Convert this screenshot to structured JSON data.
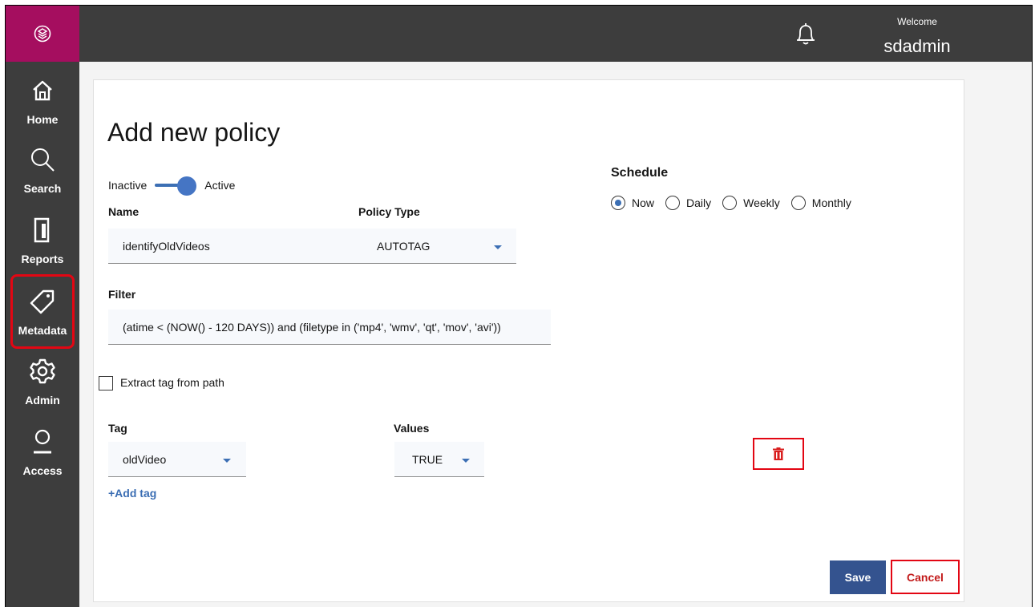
{
  "app": {
    "brand_color": "#a50e5f",
    "sidebar_color": "#3d3d3d",
    "accent": "#3c6fb4",
    "danger": "#e30613"
  },
  "header": {
    "welcome": "Welcome",
    "username": "sdadmin",
    "notification_icon": "bell-icon"
  },
  "sidebar": {
    "items": [
      {
        "label": "Home",
        "icon": "home-icon"
      },
      {
        "label": "Search",
        "icon": "search-icon"
      },
      {
        "label": "Reports",
        "icon": "reports-icon"
      },
      {
        "label": "Metadata",
        "icon": "tag-icon",
        "selected": true
      },
      {
        "label": "Admin",
        "icon": "gear-icon"
      },
      {
        "label": "Access",
        "icon": "user-icon"
      }
    ]
  },
  "form": {
    "title": "Add new policy",
    "toggle": {
      "off_label": "Inactive",
      "on_label": "Active",
      "value": "Active"
    },
    "name": {
      "label": "Name",
      "value": "identifyOldVideos"
    },
    "policy_type": {
      "label": "Policy Type",
      "value": "AUTOTAG"
    },
    "filter": {
      "label": "Filter",
      "value": "(atime < (NOW() - 120 DAYS)) and (filetype in ('mp4', 'wmv', 'qt', 'mov', 'avi'))"
    },
    "extract_tag": {
      "label": "Extract tag from path",
      "checked": false
    },
    "tag": {
      "label": "Tag",
      "value": "oldVideo"
    },
    "values": {
      "label": "Values",
      "value": "TRUE"
    },
    "add_tag": "+Add tag",
    "delete_icon": "trash-icon",
    "save": "Save",
    "cancel": "Cancel"
  },
  "schedule": {
    "title": "Schedule",
    "options": [
      "Now",
      "Daily",
      "Weekly",
      "Monthly"
    ],
    "selected": "Now"
  }
}
